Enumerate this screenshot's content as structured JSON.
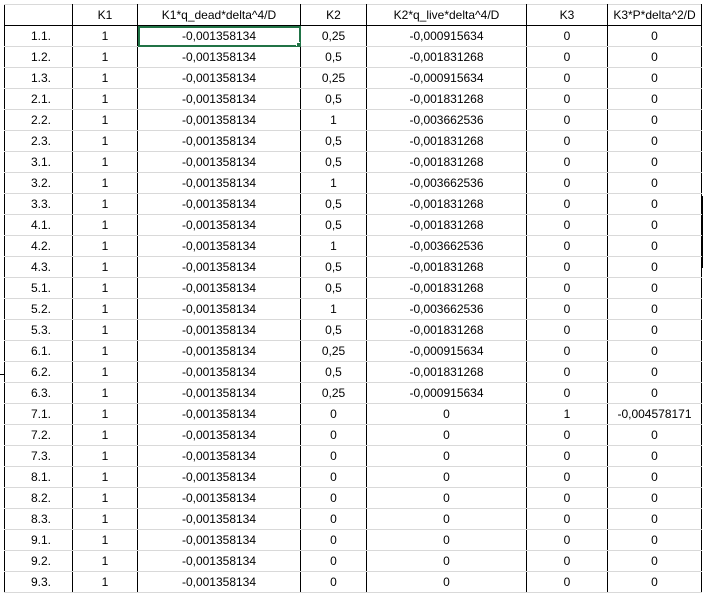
{
  "columns": [
    "",
    "K1",
    "K1*q_dead*delta^4/D",
    "K2",
    "K2*q_live*delta^4/D",
    "K3",
    "K3*P*delta^2/D"
  ],
  "rows": [
    [
      "1.1.",
      "1",
      "-0,001358134",
      "0,25",
      "-0,000915634",
      "0",
      "0"
    ],
    [
      "1.2.",
      "1",
      "-0,001358134",
      "0,5",
      "-0,001831268",
      "0",
      "0"
    ],
    [
      "1.3.",
      "1",
      "-0,001358134",
      "0,25",
      "-0,000915634",
      "0",
      "0"
    ],
    [
      "2.1.",
      "1",
      "-0,001358134",
      "0,5",
      "-0,001831268",
      "0",
      "0"
    ],
    [
      "2.2.",
      "1",
      "-0,001358134",
      "1",
      "-0,003662536",
      "0",
      "0"
    ],
    [
      "2.3.",
      "1",
      "-0,001358134",
      "0,5",
      "-0,001831268",
      "0",
      "0"
    ],
    [
      "3.1.",
      "1",
      "-0,001358134",
      "0,5",
      "-0,001831268",
      "0",
      "0"
    ],
    [
      "3.2.",
      "1",
      "-0,001358134",
      "1",
      "-0,003662536",
      "0",
      "0"
    ],
    [
      "3.3.",
      "1",
      "-0,001358134",
      "0,5",
      "-0,001831268",
      "0",
      "0"
    ],
    [
      "4.1.",
      "1",
      "-0,001358134",
      "0,5",
      "-0,001831268",
      "0",
      "0"
    ],
    [
      "4.2.",
      "1",
      "-0,001358134",
      "1",
      "-0,003662536",
      "0",
      "0"
    ],
    [
      "4.3.",
      "1",
      "-0,001358134",
      "0,5",
      "-0,001831268",
      "0",
      "0"
    ],
    [
      "5.1.",
      "1",
      "-0,001358134",
      "0,5",
      "-0,001831268",
      "0",
      "0"
    ],
    [
      "5.2.",
      "1",
      "-0,001358134",
      "1",
      "-0,003662536",
      "0",
      "0"
    ],
    [
      "5.3.",
      "1",
      "-0,001358134",
      "0,5",
      "-0,001831268",
      "0",
      "0"
    ],
    [
      "6.1.",
      "1",
      "-0,001358134",
      "0,25",
      "-0,000915634",
      "0",
      "0"
    ],
    [
      "6.2.",
      "1",
      "-0,001358134",
      "0,5",
      "-0,001831268",
      "0",
      "0"
    ],
    [
      "6.3.",
      "1",
      "-0,001358134",
      "0,25",
      "-0,000915634",
      "0",
      "0"
    ],
    [
      "7.1.",
      "1",
      "-0,001358134",
      "0",
      "0",
      "1",
      "-0,004578171"
    ],
    [
      "7.2.",
      "1",
      "-0,001358134",
      "0",
      "0",
      "0",
      "0"
    ],
    [
      "7.3.",
      "1",
      "-0,001358134",
      "0",
      "0",
      "0",
      "0"
    ],
    [
      "8.1.",
      "1",
      "-0,001358134",
      "0",
      "0",
      "0",
      "0"
    ],
    [
      "8.2.",
      "1",
      "-0,001358134",
      "0",
      "0",
      "0",
      "0"
    ],
    [
      "8.3.",
      "1",
      "-0,001358134",
      "0",
      "0",
      "0",
      "0"
    ],
    [
      "9.1.",
      "1",
      "-0,001358134",
      "0",
      "0",
      "0",
      "0"
    ],
    [
      "9.2.",
      "1",
      "-0,001358134",
      "0",
      "0",
      "0",
      "0"
    ],
    [
      "9.3.",
      "1",
      "-0,001358134",
      "0",
      "0",
      "0",
      "0"
    ]
  ]
}
